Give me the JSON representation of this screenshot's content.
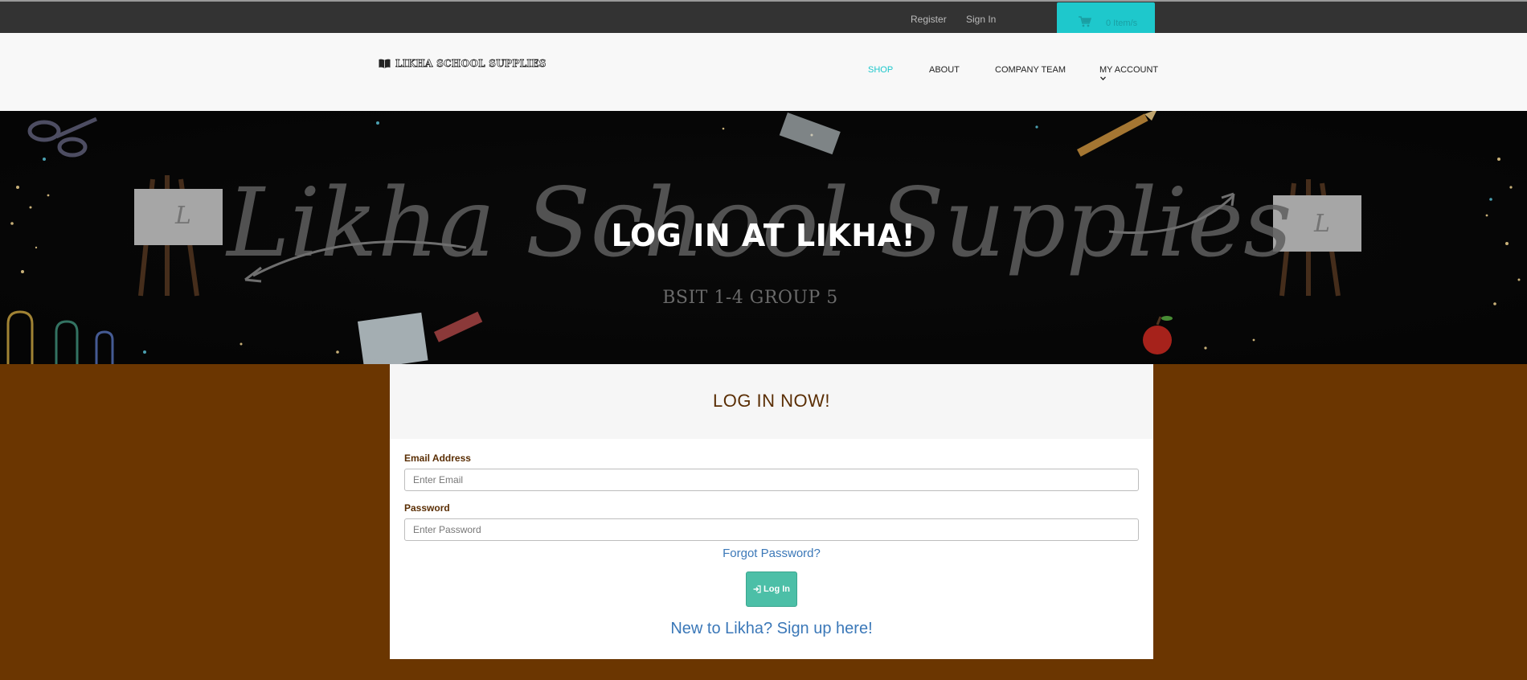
{
  "topbar": {
    "register_label": "Register",
    "signin_label": "Sign In",
    "cart_label": "0 Item/s",
    "cart_icon": "shopping-cart-icon",
    "cart_color": "#1ec8cc"
  },
  "header": {
    "logo_text": "LIKHA SCHOOL SUPPLIES",
    "logo_icon": "open-book-icon",
    "nav": {
      "shop": "SHOP",
      "about": "ABOUT",
      "team": "COMPANY TEAM",
      "account": "MY ACCOUNT"
    },
    "active_color": "#1ec8cc"
  },
  "hero": {
    "background_script_text": "Likha School Supplies",
    "easel_letter": "L",
    "title": "LOG IN AT LIKHA!",
    "subtitle": "BSIT 1-4 GROUP 5"
  },
  "login": {
    "heading": "LOG IN NOW!",
    "email_label": "Email Address",
    "email_placeholder": "Enter Email",
    "email_value": "",
    "password_label": "Password",
    "password_placeholder": "Enter Password",
    "password_value": "",
    "forgot_label": "Forgot Password?",
    "button_label": "Log In",
    "button_icon": "sign-in-icon",
    "signup_label": "New to Likha? Sign up here!"
  },
  "colors": {
    "page_background": "#6b3601",
    "topbar": "#333333",
    "button": "#4cbfa7",
    "link": "#3b78b8",
    "label": "#5a2e04"
  }
}
